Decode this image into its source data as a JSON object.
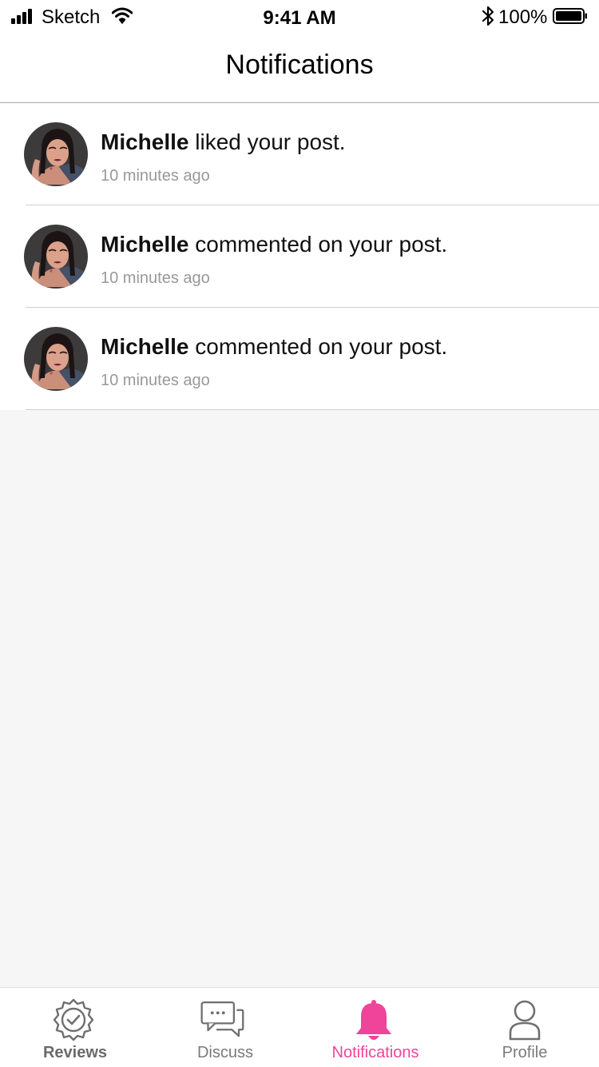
{
  "status_bar": {
    "carrier": "Sketch",
    "time": "9:41 AM",
    "battery": "100%"
  },
  "header": {
    "title": "Notifications"
  },
  "notifications": [
    {
      "name": "Michelle",
      "action": " liked your post.",
      "time": "10 minutes ago"
    },
    {
      "name": "Michelle",
      "action": " commented on your post.",
      "time": "10 minutes ago"
    },
    {
      "name": "Michelle",
      "action": " commented on your post.",
      "time": "10 minutes ago"
    }
  ],
  "tab_bar": {
    "items": [
      {
        "label": "Reviews",
        "icon": "badge-check-icon"
      },
      {
        "label": "Discuss",
        "icon": "chat-bubbles-icon"
      },
      {
        "label": "Notifications",
        "icon": "bell-icon",
        "active": true
      },
      {
        "label": "Profile",
        "icon": "person-icon"
      }
    ]
  },
  "colors": {
    "accent": "#f0449a",
    "background": "#f6f6f6",
    "muted_text": "#999999"
  }
}
